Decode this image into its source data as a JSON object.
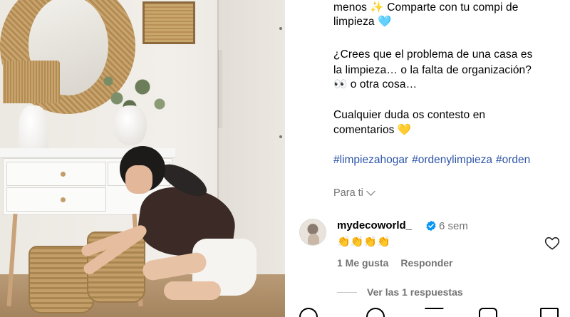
{
  "caption": {
    "line1": "menos ✨ Comparte con tu compi de",
    "line2": "limpieza 🩵",
    "line3": "¿Crees que el problema de una casa es",
    "line4": "la limpieza… o la falta de organización?",
    "line5": "👀 o otra cosa…",
    "line6": "Cualquier duda os contesto en",
    "line7": "comentarios 💛"
  },
  "hashtags": [
    "#limpiezahogar",
    "#ordenylimpieza",
    "#orden"
  ],
  "translate_label": "Para ti",
  "comment": {
    "username": "mydecoworld_",
    "time": "6 sem",
    "text": "👏👏👏👏",
    "likes_label": "1 Me gusta",
    "reply_label": "Responder",
    "view_replies_label": "Ver las 1 respuestas"
  },
  "colors": {
    "hashtag": "#2e56a8",
    "muted": "#737373",
    "verified": "#0095f6"
  }
}
